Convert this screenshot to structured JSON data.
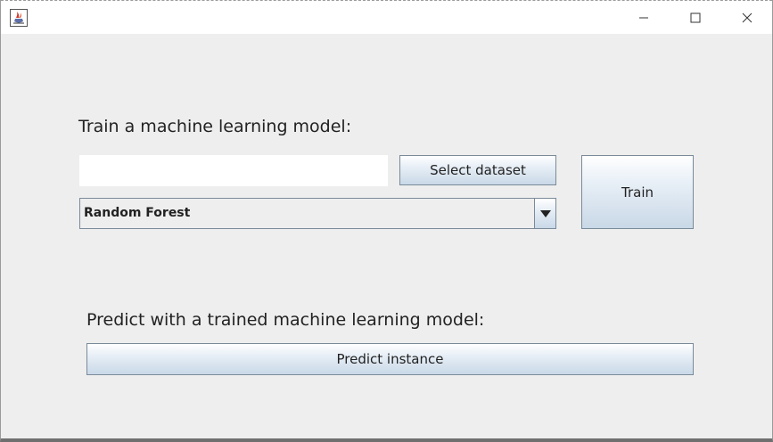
{
  "window": {
    "app_icon": "java-cup-icon",
    "controls": {
      "minimize_icon": "minimize-icon",
      "maximize_icon": "maximize-icon",
      "close_icon": "close-icon"
    }
  },
  "train": {
    "heading": "Train a machine learning model:",
    "dataset_field_value": "",
    "select_dataset_label": "Select dataset",
    "train_label": "Train",
    "model_select": {
      "selected": "Random Forest",
      "arrow_icon": "dropdown-arrow-icon"
    }
  },
  "predict": {
    "heading": "Predict with a trained machine learning model:",
    "predict_label": "Predict instance"
  },
  "colors": {
    "window_bg": "#eeeeee",
    "titlebar_bg": "#ffffff",
    "button_gradient_top": "#ffffff",
    "button_gradient_bottom": "#c9d8e7",
    "border": "#7a8a99"
  }
}
